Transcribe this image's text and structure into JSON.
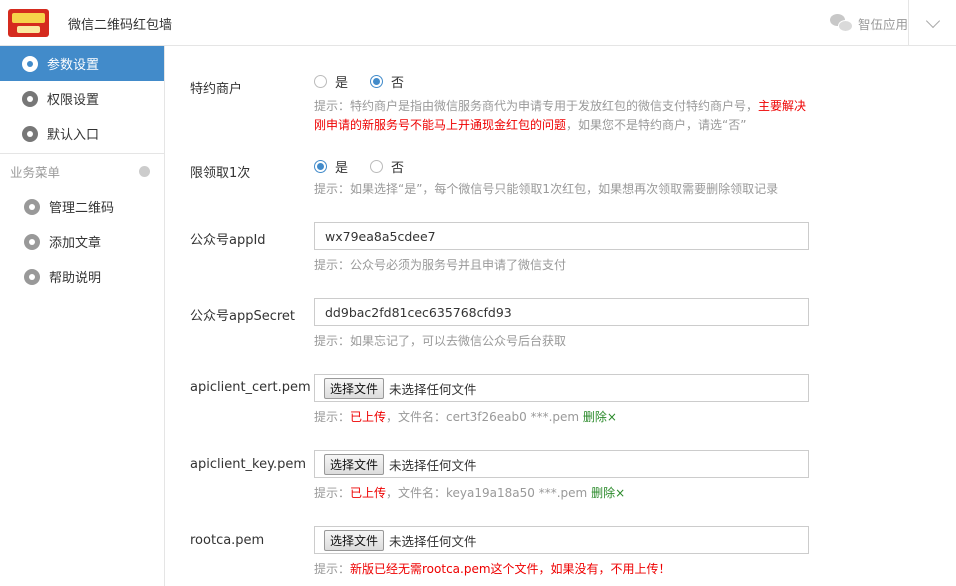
{
  "header": {
    "app_title": "微信二维码红包墙",
    "right_label": "智伍应用",
    "logo_text": "红包墙"
  },
  "sidebar": {
    "items": [
      {
        "label": "参数设置",
        "active": true
      },
      {
        "label": "权限设置",
        "active": false
      },
      {
        "label": "默认入口",
        "active": false
      }
    ],
    "section_title": "业务菜单",
    "section_items": [
      {
        "label": "管理二维码"
      },
      {
        "label": "添加文章"
      },
      {
        "label": "帮助说明"
      }
    ]
  },
  "form": {
    "special_merchant": {
      "label": "特约商户",
      "options": [
        "是",
        "否"
      ],
      "selected": "否",
      "hint_prefix": "提示：特约商户是指由微信服务商代为申请专用于发放红包的微信支付特约商户号，",
      "hint_red": "主要解决刚申请的新服务号不能马上开通现金红包的问题",
      "hint_suffix": "，如果您不是特约商户，请选“否”"
    },
    "limit_once": {
      "label": "限领取1次",
      "options": [
        "是",
        "否"
      ],
      "selected": "是",
      "hint": "提示：如果选择“是”，每个微信号只能领取1次红包，如果想再次领取需要删除领取记录"
    },
    "appid": {
      "label": "公众号appId",
      "value": "wx79ea8a5cdee7",
      "hint": "提示：公众号必须为服务号并且申请了微信支付"
    },
    "appsecret": {
      "label": "公众号appSecret",
      "value": "dd9bac2fd81cec635768cfd93",
      "hint": "提示：如果忘记了，可以去微信公众号后台获取"
    },
    "cert": {
      "label": "apiclient_cert.pem",
      "button": "选择文件",
      "no_file": "未选择任何文件",
      "hint_prefix": "提示：",
      "uploaded": "已上传",
      "filename_label": "，文件名：cert3f26eab0 ***.pem",
      "delete": "删除×"
    },
    "key": {
      "label": "apiclient_key.pem",
      "button": "选择文件",
      "no_file": "未选择任何文件",
      "hint_prefix": "提示：",
      "uploaded": "已上传",
      "filename_label": "，文件名：keya19a18a50 ***.pem",
      "delete": "删除×"
    },
    "rootca": {
      "label": "rootca.pem",
      "button": "选择文件",
      "no_file": "未选择任何文件",
      "hint_prefix": "提示：",
      "hint_red": "新版已经无需rootca.pem这个文件，如果没有，不用上传！"
    }
  },
  "colors": {
    "accent": "#428bca",
    "warning": "#e00000",
    "delete": "#2a8a2a"
  }
}
